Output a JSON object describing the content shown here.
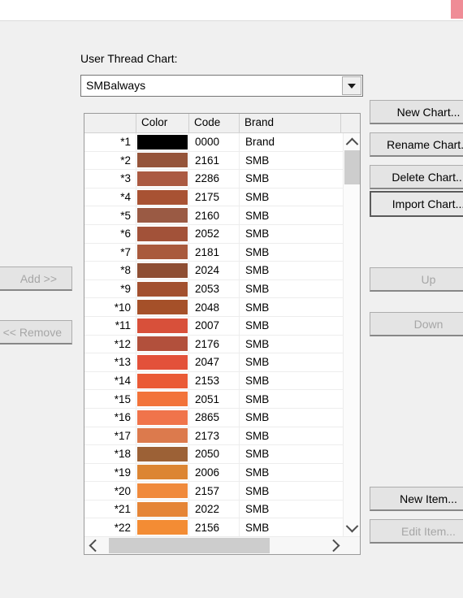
{
  "window": {
    "close_chip_color": "#ef8c96"
  },
  "form": {
    "label": "User Thread Chart:",
    "chart_select": {
      "value": "SMBalways",
      "arrow_icon": "chevron-down-icon"
    }
  },
  "grid": {
    "columns": [
      "",
      "Color",
      "Code",
      "Brand"
    ],
    "rows": [
      {
        "index": "*1",
        "color": "#000000",
        "code": "0000",
        "brand": "Brand"
      },
      {
        "index": "*2",
        "color": "#95543a",
        "code": "2161",
        "brand": "SMB"
      },
      {
        "index": "*3",
        "color": "#ab5a42",
        "code": "2286",
        "brand": "SMB"
      },
      {
        "index": "*4",
        "color": "#a85233",
        "code": "2175",
        "brand": "SMB"
      },
      {
        "index": "*5",
        "color": "#9a5a44",
        "code": "2160",
        "brand": "SMB"
      },
      {
        "index": "*6",
        "color": "#a25239",
        "code": "2052",
        "brand": "SMB"
      },
      {
        "index": "*7",
        "color": "#a95a3d",
        "code": "2181",
        "brand": "SMB"
      },
      {
        "index": "*8",
        "color": "#8e4e33",
        "code": "2024",
        "brand": "SMB"
      },
      {
        "index": "*9",
        "color": "#a2502f",
        "code": "2053",
        "brand": "SMB"
      },
      {
        "index": "*10",
        "color": "#a55029",
        "code": "2048",
        "brand": "SMB"
      },
      {
        "index": "*11",
        "color": "#d8503a",
        "code": "2007",
        "brand": "SMB"
      },
      {
        "index": "*12",
        "color": "#b2503c",
        "code": "2176",
        "brand": "SMB"
      },
      {
        "index": "*13",
        "color": "#e3513a",
        "code": "2047",
        "brand": "SMB"
      },
      {
        "index": "*14",
        "color": "#ea5a36",
        "code": "2153",
        "brand": "SMB"
      },
      {
        "index": "*15",
        "color": "#f2733a",
        "code": "2051",
        "brand": "SMB"
      },
      {
        "index": "*16",
        "color": "#f0744b",
        "code": "2865",
        "brand": "SMB"
      },
      {
        "index": "*17",
        "color": "#dc7a4d",
        "code": "2173",
        "brand": "SMB"
      },
      {
        "index": "*18",
        "color": "#9c6136",
        "code": "2050",
        "brand": "SMB"
      },
      {
        "index": "*19",
        "color": "#dc8533",
        "code": "2006",
        "brand": "SMB"
      },
      {
        "index": "*20",
        "color": "#f08a3c",
        "code": "2157",
        "brand": "SMB"
      },
      {
        "index": "*21",
        "color": "#e58537",
        "code": "2022",
        "brand": "SMB"
      },
      {
        "index": "*22",
        "color": "#f38c34",
        "code": "2156",
        "brand": "SMB"
      }
    ],
    "vertical_scrollbar": {
      "up_icon": "chevron-up-icon",
      "down_icon": "chevron-down-icon"
    },
    "horizontal_scrollbar": {
      "left_icon": "chevron-left-icon",
      "right_icon": "chevron-right-icon"
    }
  },
  "buttons": {
    "new_chart": "New Chart...",
    "rename_chart": "Rename Chart...",
    "delete_chart": "Delete Chart...",
    "import_chart": "Import Chart...",
    "up": "Up",
    "down": "Down",
    "new_item": "New Item...",
    "edit_item": "Edit Item...",
    "add": "Add >>",
    "remove": "<< Remove"
  }
}
